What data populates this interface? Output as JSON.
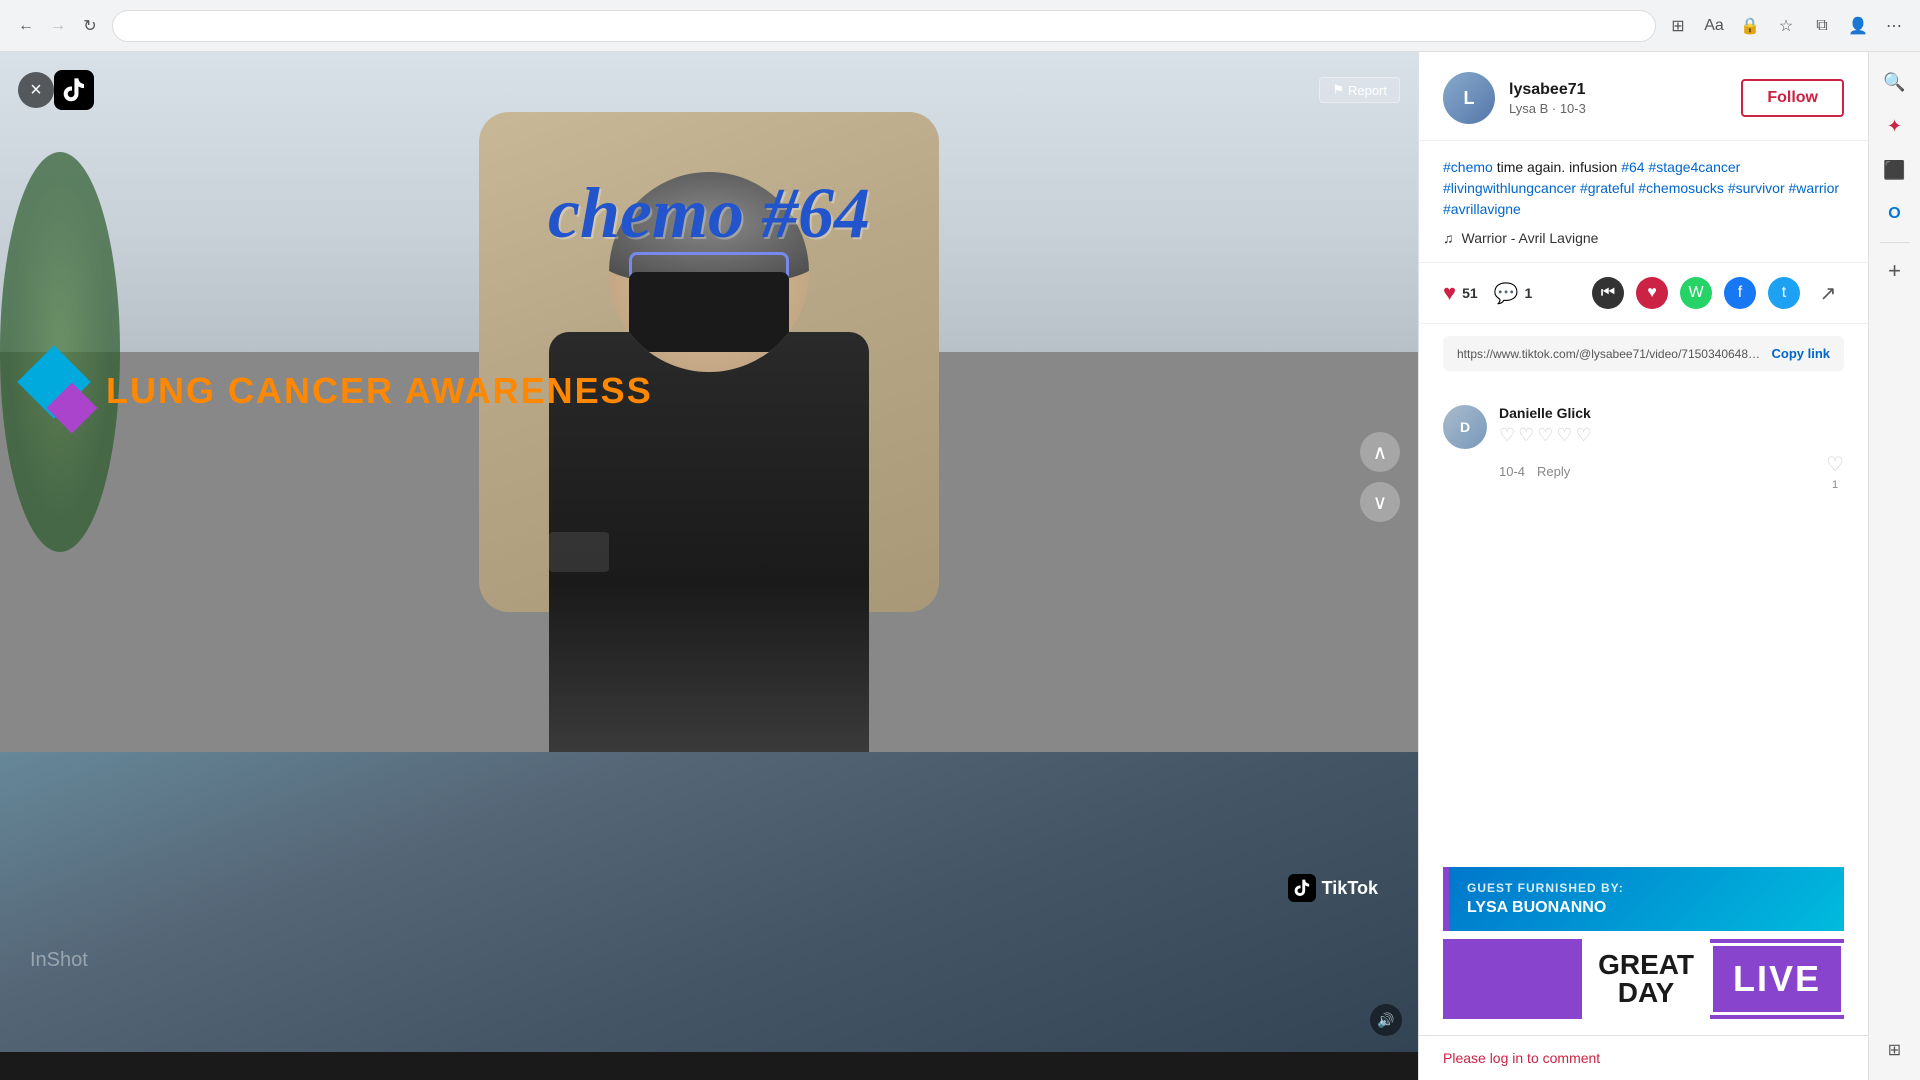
{
  "browser": {
    "url": "https://www.tiktok.com/@lysabee71/video/7150340648397327659?is_copy_url=1&is_from_webapp=v1&lang=en",
    "back_disabled": false,
    "forward_disabled": true
  },
  "video": {
    "chemo_text": "chemo #64",
    "report_label": "Report",
    "close_label": "×",
    "nav_up_label": "∧",
    "nav_down_label": "∨",
    "awareness_text": "LUNG CANCER AWARENESS",
    "tiktok_watermark": "TikTok",
    "inshotvideo_text": "InShot",
    "volume_icon": "🔊"
  },
  "sidebar": {
    "author": {
      "name": "lysabee71",
      "subtitle": "Lysa B · 10-3",
      "avatar_initials": "L"
    },
    "follow_label": "Follow",
    "caption": "#chemo time again. infusion #64 #stage4cancer #livingwithlungcancer #grateful #chemosucks #survivor #warrior #avrillavigne",
    "music": "Warrior - Avril Lavigne",
    "likes_count": "51",
    "comments_count": "1",
    "link_url": "https://www.tiktok.com/@lysabee71/video/7150340648397...",
    "copy_link_label": "Copy link",
    "comments": [
      {
        "author": "Danielle Glick",
        "avatar_initials": "D",
        "hearts": "♡♡♡♡♡",
        "date": "10-4",
        "reply_label": "Reply",
        "likes": "1"
      }
    ],
    "guest_label": "GUEST FURNISHED BY:",
    "guest_name": "LYSA BUONANNO",
    "gdl_great": "GREAT",
    "gdl_day": "DAY",
    "gdl_live": "LIVE",
    "comment_placeholder": "Please log in to comment"
  },
  "edge_toolbar": {
    "search_icon": "🔍",
    "star_icon": "✦",
    "app_icon": "⬛",
    "outlook_icon": "O",
    "add_icon": "+"
  },
  "colors": {
    "follow_border": "#cc2244",
    "awareness_orange": "#ff8800",
    "diamond_blue": "#00aadd",
    "diamond_purple": "#aa44cc",
    "gdl_purple": "#8844cc",
    "guest_gradient_start": "#0077cc",
    "guest_gradient_end": "#00bbdd",
    "heart_color": "#cc2244"
  }
}
